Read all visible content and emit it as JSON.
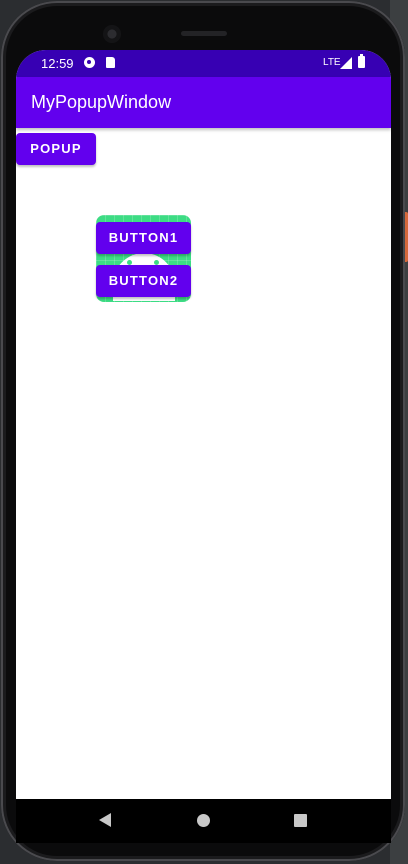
{
  "status_bar": {
    "time": "12:59",
    "network": "LTE",
    "icons": [
      "data-saver-icon",
      "sd-card-icon",
      "signal-icon",
      "battery-icon"
    ]
  },
  "app_bar": {
    "title": "MyPopupWindow"
  },
  "main": {
    "popup_button_label": "POPUP"
  },
  "popup_window": {
    "button1_label": "BUTTON1",
    "button2_label": "BUTTON2",
    "background_icon": "android-launcher-icon"
  },
  "nav_bar": {
    "icons": [
      "back-icon",
      "home-icon",
      "recents-icon"
    ]
  },
  "colors": {
    "primary": "#6200ee",
    "primary_dark": "#3700b3",
    "android_green": "#3ddc84"
  }
}
